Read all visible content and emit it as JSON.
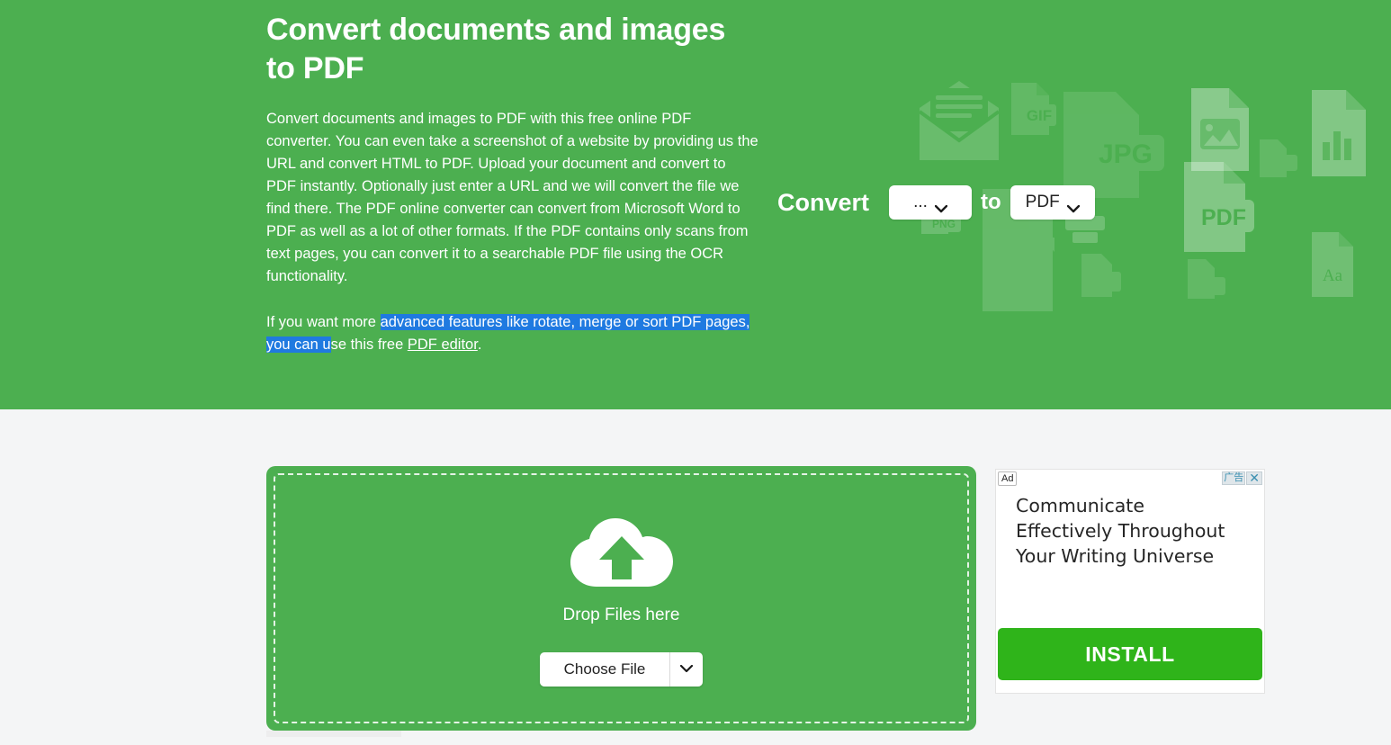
{
  "hero": {
    "title": "Convert documents and images to PDF",
    "paragraph_1": "Convert documents and images to PDF with this free online PDF converter. You can even take a screenshot of a website by providing us the URL and convert HTML to PDF. Upload your document and convert to PDF instantly. Optionally just enter a URL and we will convert the file we find there. The PDF online converter can convert from Microsoft Word to PDF as well as a lot of other formats. If the PDF contains only scans from text pages, you can convert it to a searchable PDF file using the OCR functionality.",
    "paragraph_2_pre": "If you want more ",
    "paragraph_2_selected": "advanced features like rotate, merge or sort PDF pages, you can u",
    "paragraph_2_post": "se this free ",
    "paragraph_2_link": "PDF editor",
    "paragraph_2_end": ".",
    "bg_color": "#4caf50",
    "selection_color": "#1f7ae0"
  },
  "convert_widget": {
    "label": "Convert",
    "from_value": "...",
    "to_label": "to",
    "to_value": "PDF",
    "caret_icon": "chevron-down-icon"
  },
  "decorative_icons": [
    "envelope-icon",
    "gif-file-icon",
    "jpg-file-icon",
    "image-file-icon",
    "chart-file-icon",
    "pdf-file-icon",
    "doc-file-icon",
    "png-file-icon",
    "graph-file-icon",
    "video-file-icon",
    "text-aa-file-icon",
    "printer-icon"
  ],
  "strip_colors": [
    "#1e6b2b",
    "#2f7d36",
    "#358f3d",
    "#3ba046",
    "#4caf50",
    "#72c174",
    "#93d095"
  ],
  "dropzone": {
    "cloud_icon": "cloud-upload-icon",
    "drop_label": "Drop Files here",
    "choose_file_label": "Choose File",
    "choose_caret_icon": "chevron-down-icon",
    "bg_color": "#4caf50"
  },
  "ad": {
    "badge_label": "Ad",
    "cn_badge_label": "广告",
    "close_icon": "close-icon",
    "headline": "Communicate Effectively Throughout Your Writing Universe",
    "cta_label": "INSTALL",
    "cta_color": "#2fb41a"
  }
}
